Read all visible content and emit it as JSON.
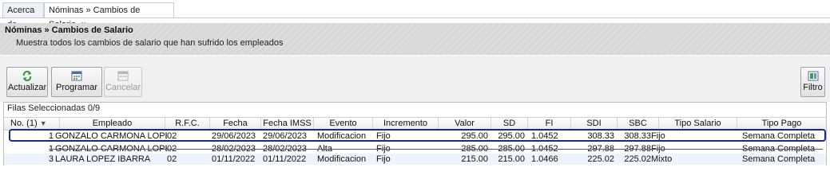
{
  "tabs": [
    {
      "label": "Acerca de",
      "active": false
    },
    {
      "label": "Nóminas » Cambios de Salario",
      "active": true,
      "close": "×"
    }
  ],
  "header": {
    "title": "Nóminas » Cambios de Salario",
    "description": "Muestra todos los cambios de salario que han sufrido los empleados"
  },
  "toolbar": {
    "actualizar": "Actualizar",
    "programar": "Programar",
    "cancelar": "Cancelar",
    "filtro": "Filtro"
  },
  "grid": {
    "selection_info": "Filas Seleccionadas 0/9",
    "columns": [
      "No. (1)",
      "Empleado",
      "R.F.C.",
      "Fecha",
      "Fecha IMSS",
      "Evento",
      "Incremento",
      "Valor",
      "SD",
      "FI",
      "SDI",
      "SBC",
      "Tipo Salario",
      "Tipo Pago"
    ],
    "sort_indicator": "▼",
    "rows": [
      [
        "1",
        "GONZALO CARMONA LOPEZ",
        "02",
        "29/06/2023",
        "29/06/2023",
        "Modificacion",
        "Fijo",
        "295.00",
        "295.00",
        "1.0452",
        "308.33",
        "308.33",
        "Fijo",
        "Semana Completa"
      ],
      [
        "1",
        "GONZALO CARMONA LOPEZ",
        "02",
        "28/02/2023",
        "28/02/2023",
        "Alta",
        "Fijo",
        "285.00",
        "285.00",
        "1.0452",
        "297.88",
        "297.88",
        "Fijo",
        "Semana Completa"
      ],
      [
        "3",
        "LAURA LOPEZ IBARRA",
        "02",
        "01/11/2022",
        "01/11/2022",
        "Modificacion",
        "Fijo",
        "215.00",
        "215.00",
        "1.0466",
        "225.02",
        "225.02",
        "Mixto",
        "Semana Completa"
      ]
    ]
  },
  "colors": {
    "selection_outline": "#1a2a8c",
    "header_band": "#d8d8d8"
  }
}
